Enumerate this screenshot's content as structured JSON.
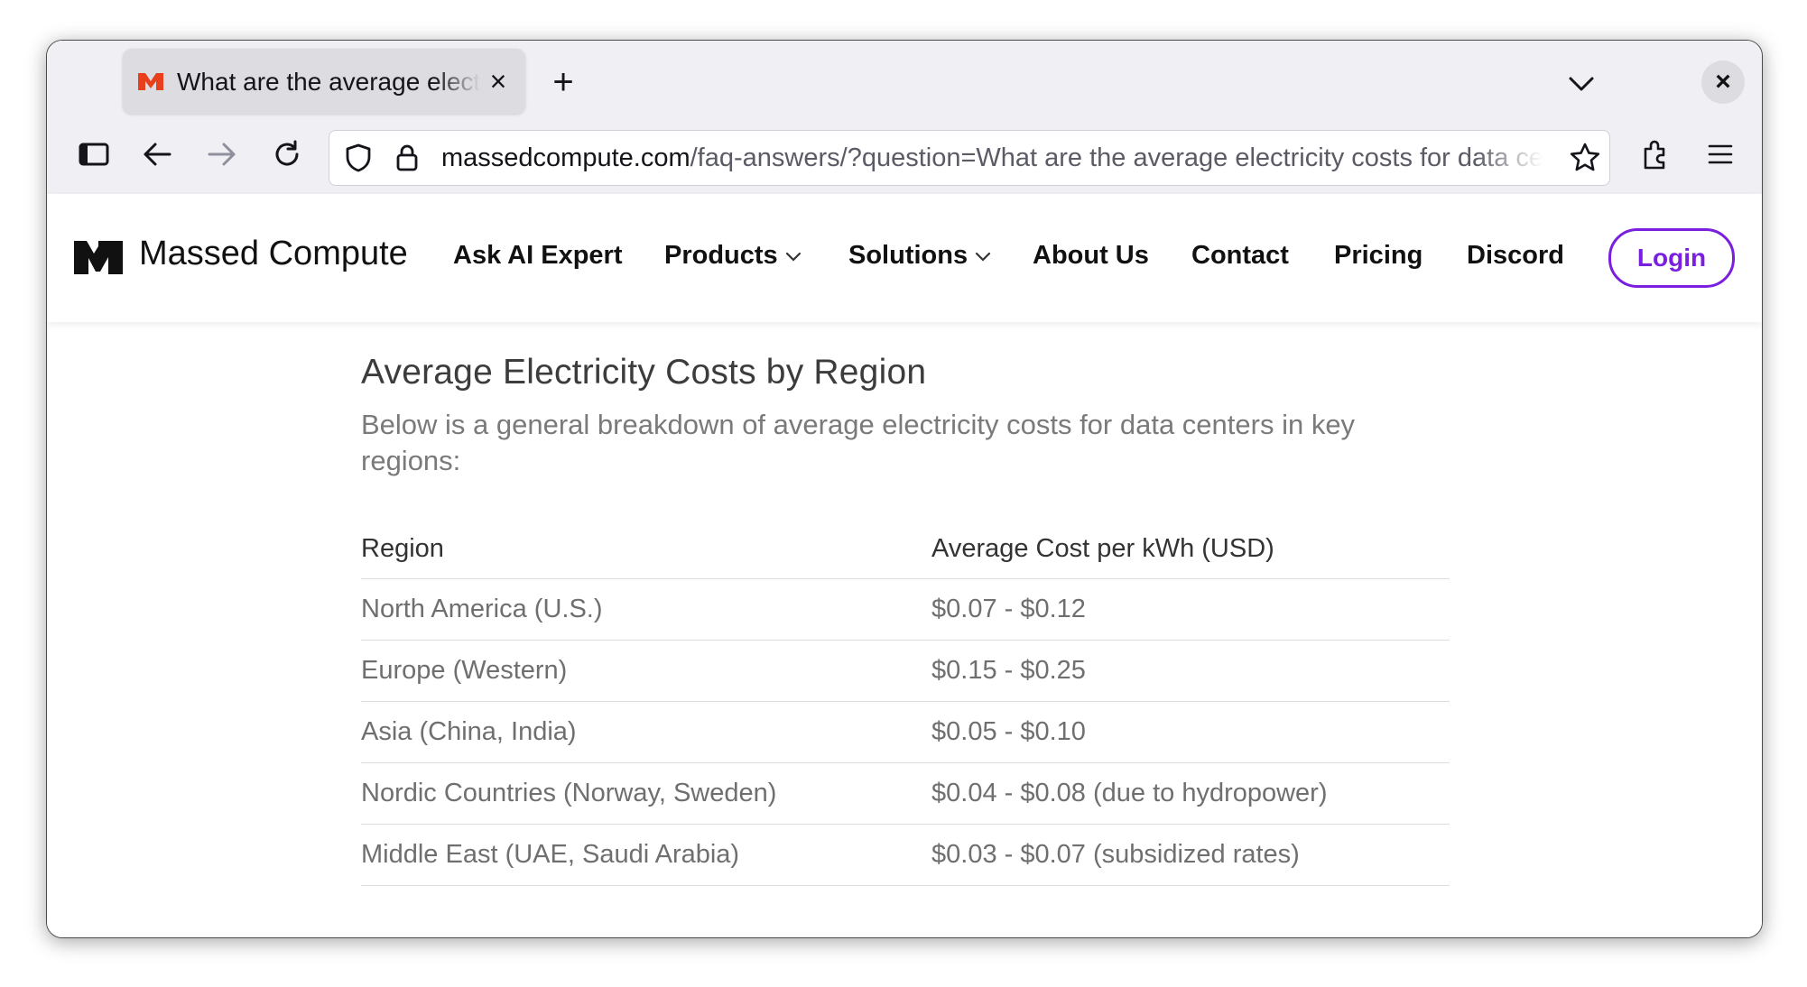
{
  "browser": {
    "tab_title": "What are the average electricity costs for data centers",
    "tab_close": "×",
    "new_tab": "+",
    "window_close": "×",
    "url_domain": "massedcompute.com",
    "url_path": "/faq-answers/?question=What are the average electricity costs for data centers in different regions?"
  },
  "site": {
    "brand": "Massed Compute",
    "nav": {
      "ask_ai": "Ask AI Expert",
      "products": "Products",
      "solutions": "Solutions",
      "about": "About Us",
      "contact": "Contact",
      "pricing": "Pricing",
      "discord": "Discord"
    },
    "login": "Login",
    "accent_color": "#7a1fe0",
    "favicon_color": "#e8401c"
  },
  "article": {
    "heading": "Average Electricity Costs by Region",
    "intro": "Below is a general breakdown of average electricity costs for data centers in key regions:",
    "table": {
      "headers": [
        "Region",
        "Average Cost per kWh (USD)"
      ],
      "rows": [
        [
          "North America (U.S.)",
          "$0.07 - $0.12"
        ],
        [
          "Europe (Western)",
          "$0.15 - $0.25"
        ],
        [
          "Asia (China, India)",
          "$0.05 - $0.10"
        ],
        [
          "Nordic Countries (Norway, Sweden)",
          "$0.04 - $0.08 (due to hydropower)"
        ],
        [
          "Middle East (UAE, Saudi Arabia)",
          "$0.03 - $0.07 (subsidized rates)"
        ]
      ]
    }
  }
}
